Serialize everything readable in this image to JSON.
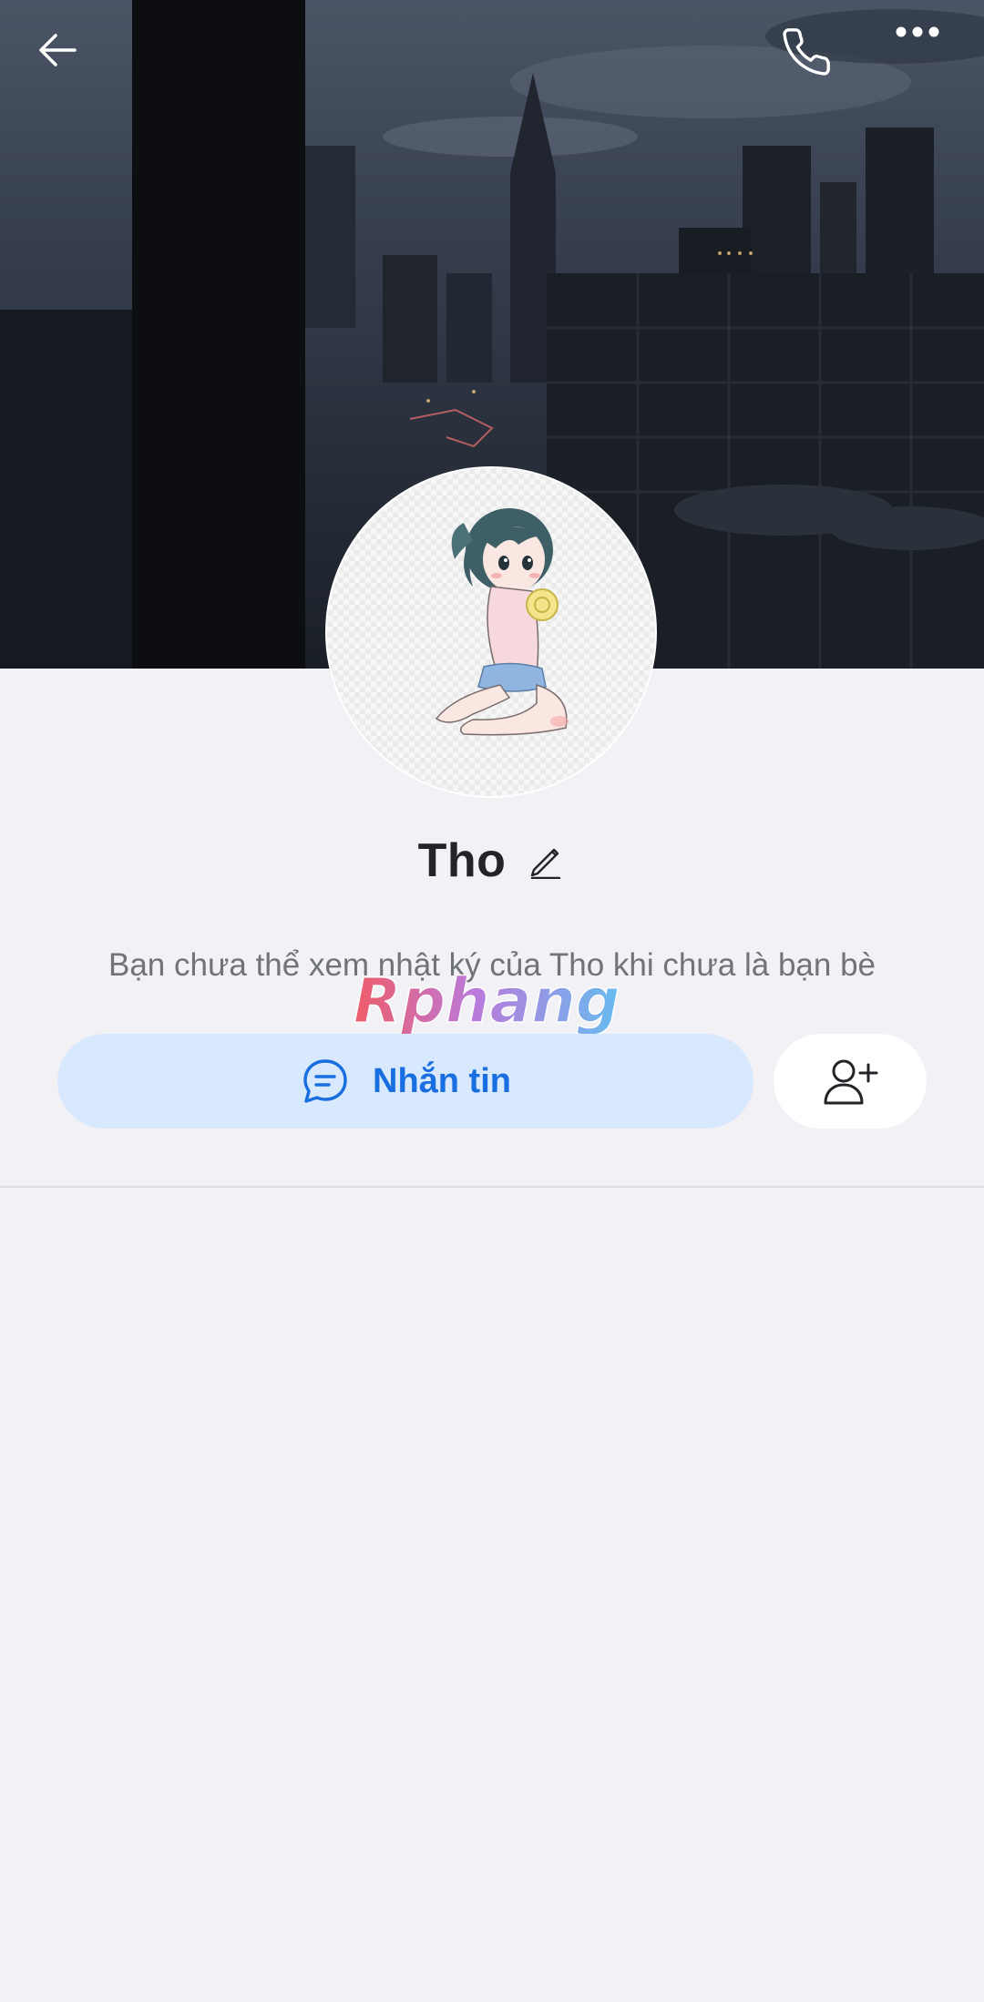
{
  "header": {
    "back_icon": "arrow-left-icon",
    "call_icon": "phone-icon",
    "more_icon": "more-horizontal-icon"
  },
  "profile": {
    "name": "Tho",
    "edit_icon": "pencil-icon",
    "notice": "Bạn chưa thể xem nhật ký của Tho khi chưa là bạn bè"
  },
  "actions": {
    "message_label": "Nhắn tin",
    "message_icon": "chat-bubble-icon",
    "add_friend_icon": "user-plus-icon"
  },
  "watermark": {
    "text": "Rphang"
  },
  "colors": {
    "background": "#f1f1f6",
    "primary": "#1a6fe0",
    "message_button_bg": "#d8e8fd",
    "text_dark": "#222428",
    "text_muted": "#707378"
  }
}
